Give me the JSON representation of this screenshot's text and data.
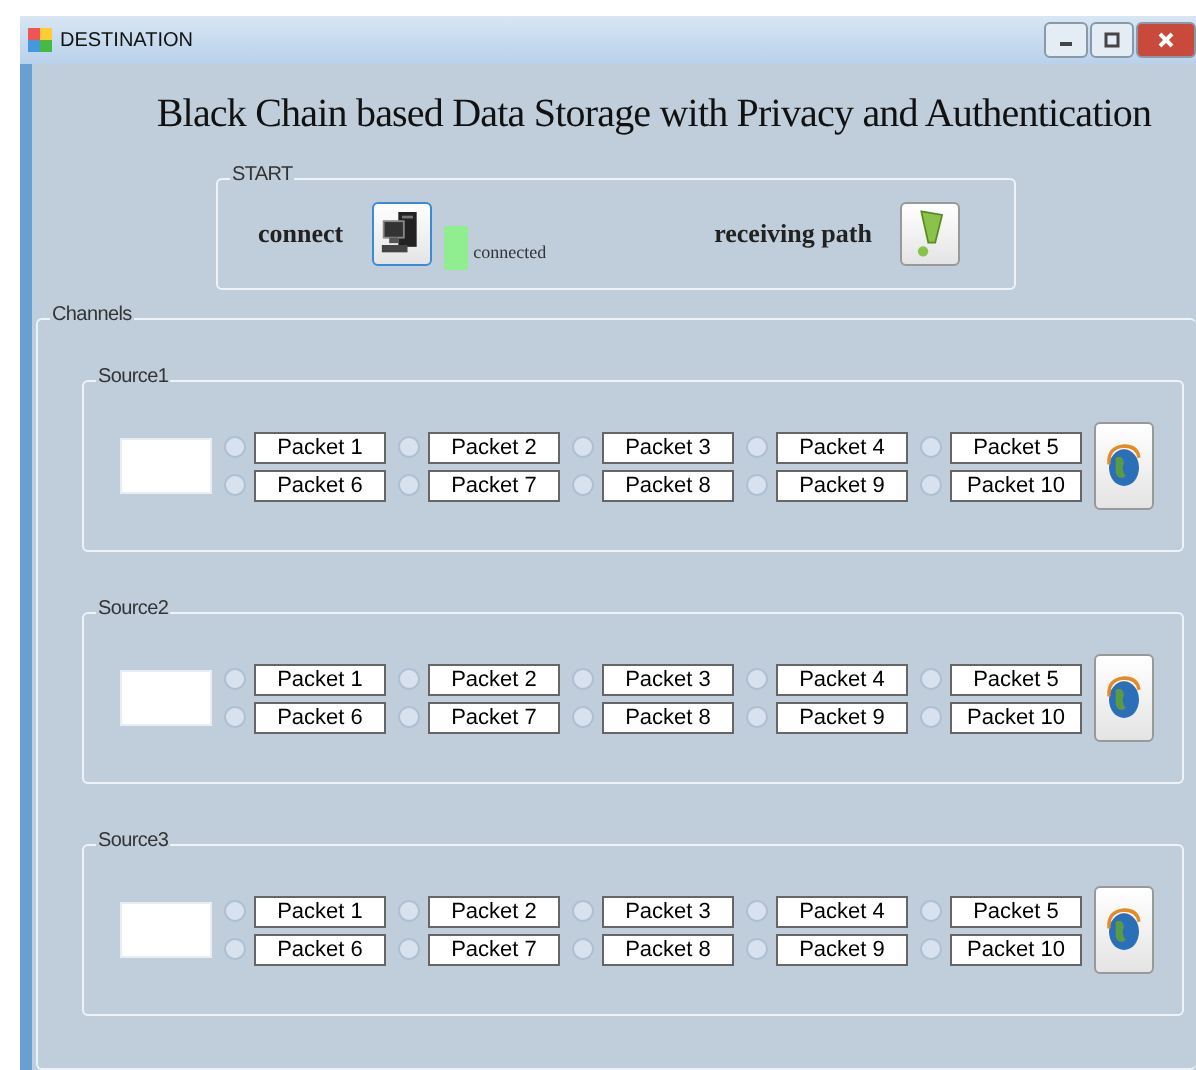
{
  "window": {
    "title": "DESTINATION"
  },
  "heading": "Black Chain based Data Storage with Privacy and Authentication",
  "start": {
    "legend": "START",
    "connect_label": "connect",
    "connected": true,
    "status_text": "connected",
    "receiving_label": "receiving path"
  },
  "channels": {
    "legend": "Channels",
    "sources": [
      {
        "legend": "Source1",
        "packets": [
          {
            "label": "Packet 1",
            "selected": false
          },
          {
            "label": "Packet 2",
            "selected": false
          },
          {
            "label": "Packet 3",
            "selected": false
          },
          {
            "label": "Packet 4",
            "selected": false
          },
          {
            "label": "Packet 5",
            "selected": false
          },
          {
            "label": "Packet 6",
            "selected": false
          },
          {
            "label": "Packet 7",
            "selected": false
          },
          {
            "label": "Packet 8",
            "selected": false
          },
          {
            "label": "Packet 9",
            "selected": false
          },
          {
            "label": "Packet 10",
            "selected": false
          }
        ]
      },
      {
        "legend": "Source2",
        "packets": [
          {
            "label": "Packet 1",
            "selected": false
          },
          {
            "label": "Packet 2",
            "selected": false
          },
          {
            "label": "Packet 3",
            "selected": false
          },
          {
            "label": "Packet 4",
            "selected": false
          },
          {
            "label": "Packet 5",
            "selected": false
          },
          {
            "label": "Packet 6",
            "selected": false
          },
          {
            "label": "Packet 7",
            "selected": false
          },
          {
            "label": "Packet 8",
            "selected": false
          },
          {
            "label": "Packet 9",
            "selected": false
          },
          {
            "label": "Packet 10",
            "selected": false
          }
        ]
      },
      {
        "legend": "Source3",
        "packets": [
          {
            "label": "Packet 1",
            "selected": false
          },
          {
            "label": "Packet 2",
            "selected": false
          },
          {
            "label": "Packet 3",
            "selected": false
          },
          {
            "label": "Packet 4",
            "selected": false
          },
          {
            "label": "Packet 5",
            "selected": false
          },
          {
            "label": "Packet 6",
            "selected": false
          },
          {
            "label": "Packet 7",
            "selected": false
          },
          {
            "label": "Packet 8",
            "selected": false
          },
          {
            "label": "Packet 9",
            "selected": false
          },
          {
            "label": "Packet 10",
            "selected": false
          }
        ]
      }
    ]
  }
}
